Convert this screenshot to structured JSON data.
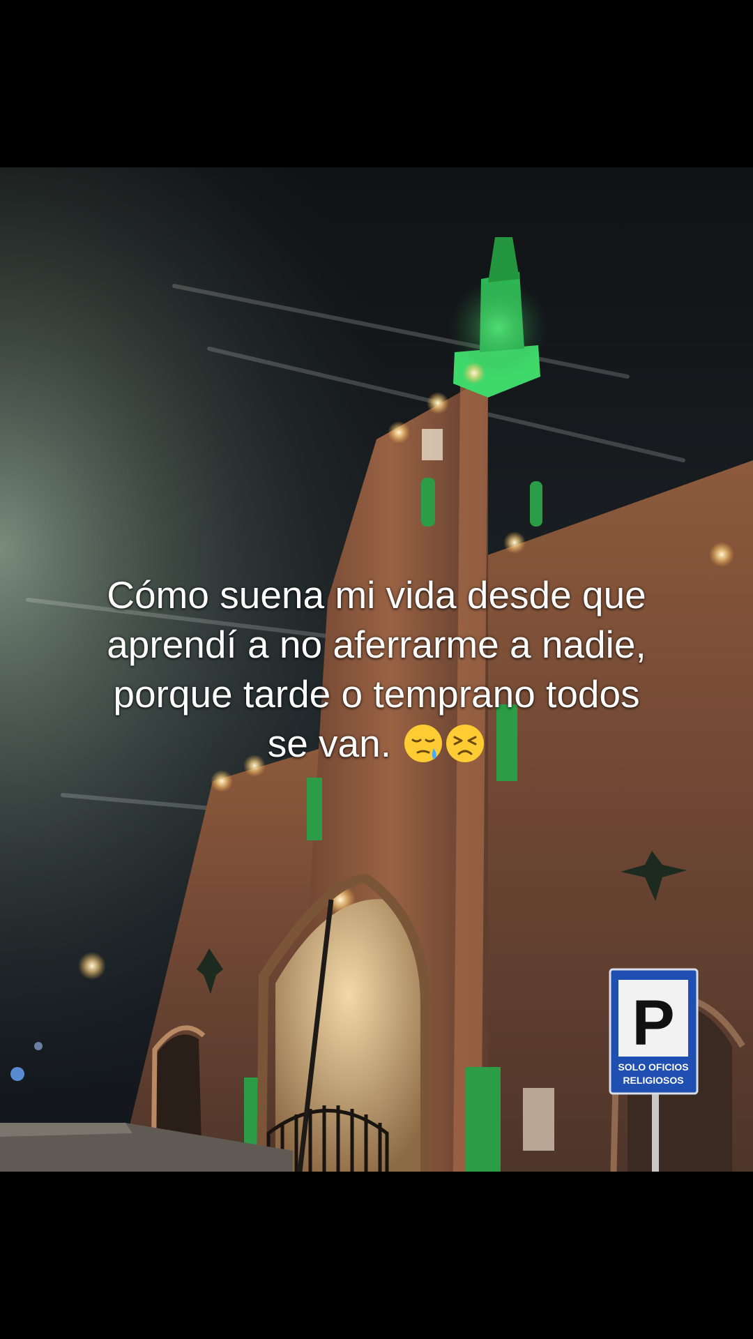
{
  "caption": {
    "line1": "Cómo suena mi vida desde que",
    "line2": "aprendí a no aferrarme a nadie,",
    "line3": "porque tarde o temprano todos",
    "line4": "se van."
  },
  "emojis": [
    "sleepy-face-icon",
    "persevering-face-icon"
  ],
  "sign": {
    "letter": "P",
    "line1": "SOLO OFICIOS",
    "line2": "RELIGIOSOS"
  },
  "colors": {
    "background": "#000000",
    "brick": "#7a4f38",
    "spire_green": "#3fd96b",
    "sign_blue": "#1f4fb0",
    "caption_text": "#ffffff"
  }
}
